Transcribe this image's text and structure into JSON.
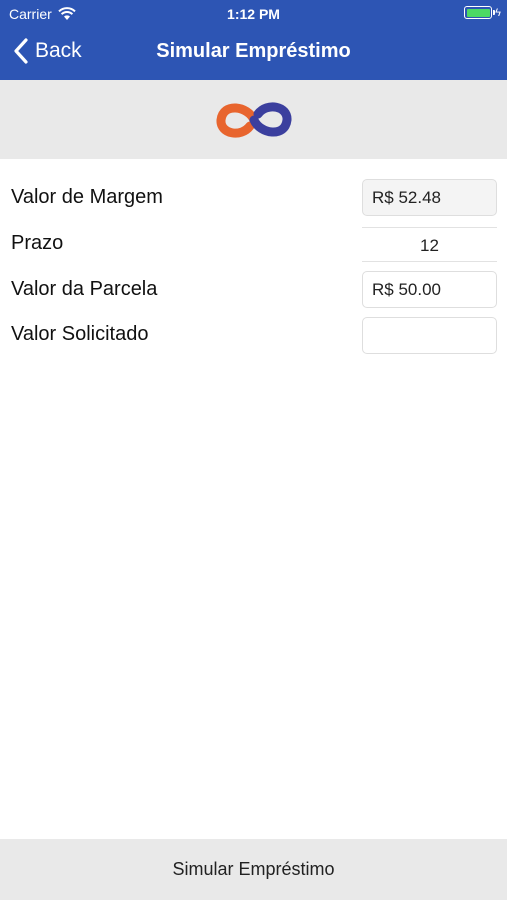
{
  "status_bar": {
    "carrier": "Carrier",
    "time": "1:12 PM",
    "battery_color": "#4cd964"
  },
  "nav": {
    "back_label": "Back",
    "title": "Simular Empréstimo",
    "background_color": "#2d55b4"
  },
  "logo": {
    "icon": "infinity-logo",
    "colors": [
      "#e8652e",
      "#3b3f9e"
    ]
  },
  "form": {
    "rows": [
      {
        "label": "Valor de Margem",
        "value": "R$ 52.48"
      },
      {
        "label": "Prazo",
        "value": "12"
      },
      {
        "label": "Valor da Parcela",
        "value": "R$ 50.00"
      },
      {
        "label": "Valor Solicitado",
        "value": ""
      }
    ]
  },
  "footer": {
    "button_label": "Simular Empréstimo"
  }
}
